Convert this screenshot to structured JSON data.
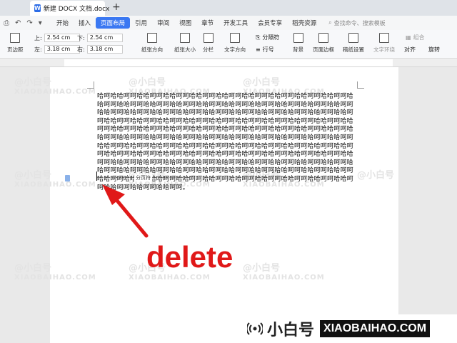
{
  "window": {
    "doc_tab_icon": "W",
    "doc_tab_title": "新建 DOCX 文档.docx",
    "new_tab_symbol": "+"
  },
  "menu": {
    "items": [
      {
        "label": "开始",
        "active": false
      },
      {
        "label": "插入",
        "active": false
      },
      {
        "label": "页面布局",
        "active": true
      },
      {
        "label": "引用",
        "active": false
      },
      {
        "label": "审阅",
        "active": false
      },
      {
        "label": "视图",
        "active": false
      },
      {
        "label": "章节",
        "active": false
      },
      {
        "label": "开发工具",
        "active": false
      },
      {
        "label": "会员专享",
        "active": false
      },
      {
        "label": "稻壳资源",
        "active": false
      }
    ],
    "search_placeholder": "查找命令、搜索模板"
  },
  "ribbon": {
    "margins_label": "页边距",
    "top_label": "上:",
    "top_value": "2.54 cm",
    "bottom_label": "下:",
    "bottom_value": "2.54 cm",
    "left_label": "左:",
    "left_value": "3.18 cm",
    "right_label": "右:",
    "right_value": "3.18 cm",
    "orientation": "纸张方向",
    "size": "纸张大小",
    "columns": "分栏",
    "text_direction": "文字方向",
    "line_numbers": "行号",
    "breaks": "分隔符",
    "background": "背景",
    "page_border": "页面边框",
    "paper_settings": "稿纸设置",
    "text_wrap": "文字环绕",
    "align": "对齐",
    "rotate": "旋转",
    "group": "组合"
  },
  "document": {
    "body_text": "哈呵哈哈呵呵哈哈呵呵哈哈呵呵哈哈呵呵哈哈呵呵哈哈呵呵哈哈呵呵哈哈呵呵哈哈呵呵哈哈呵呵哈哈呵呵哈哈呵呵哈哈呵呵哈哈呵呵哈哈呵呵哈哈呵呵哈哈呵呵哈哈呵呵哈哈呵呵哈哈呵呵哈哈呵呵哈哈呵呵哈哈呵呵哈哈呵呵哈哈呵呵哈哈呵呵哈哈呵呵哈哈呵呵哈哈呵呵哈哈呵呵哈哈呵呵哈哈呵呵哈哈呵呵哈哈呵呵哈哈呵呵哈哈呵呵哈哈呵呵哈哈呵呵哈哈呵呵哈哈呵呵哈哈呵呵哈哈呵呵哈哈呵呵哈哈呵呵哈哈呵呵哈哈呵呵哈哈呵呵哈哈呵呵哈哈呵呵哈哈呵呵哈哈呵呵哈哈呵呵哈哈呵呵哈哈呵呵哈哈呵呵哈哈呵呵哈哈呵呵哈哈呵呵哈哈呵呵哈哈呵呵哈哈呵呵哈哈呵呵哈哈呵呵哈哈呵呵哈哈呵呵哈哈呵呵哈哈呵呵哈哈呵呵哈哈呵呵哈哈呵呵哈哈呵呵哈哈呵呵哈哈呵呵哈哈呵呵哈哈呵呵哈哈呵呵哈哈呵呵哈哈呵呵哈哈呵呵哈哈呵呵哈哈呵呵哈哈呵呵哈哈呵呵哈哈呵呵哈哈呵呵哈哈呵呵哈哈呵呵哈哈呵呵哈哈呵呵哈哈呵呵哈哈呵呵哈哈呵呵哈哈呵呵哈哈呵呵哈哈呵呵哈哈呵呵哈哈呵呵哈哈呵呵哈哈呵呵哈哈呵呵哈哈呵呵哈哈呵呵哈哈呵呵哈哈呵呵哈哈呵呵哈哈呵呵哈哈呵呵哈哈呵呵哈哈呵呵哈哈呵呵。",
    "page_break_label": "分页符"
  },
  "annotation": {
    "text": "delete",
    "color": "#e01818"
  },
  "watermark": {
    "line1": "@小白号",
    "line2": "XIAOBAIHAO.COM"
  },
  "logo": {
    "cn": "小白号",
    "en": "XIAOBAIHAO.COM"
  },
  "colors": {
    "accent": "#3a78f2",
    "annotation_red": "#e01818"
  }
}
